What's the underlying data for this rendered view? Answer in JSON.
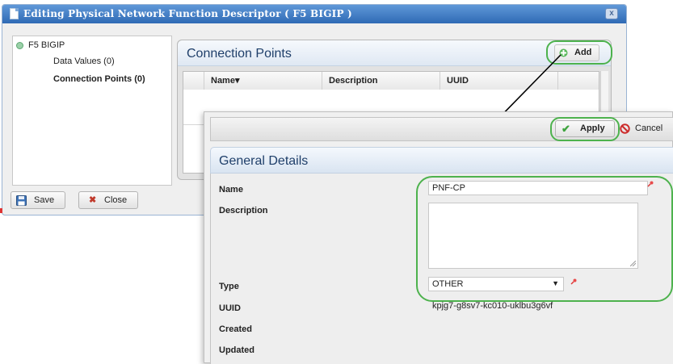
{
  "window": {
    "title": "Editing Physical Network Function Descriptor ( F5 BIGIP )",
    "close_symbol": "x"
  },
  "tree": {
    "root": "F5 BIGIP",
    "items": [
      {
        "label": "Data Values (0)"
      },
      {
        "label": "Connection Points (0)"
      }
    ]
  },
  "connection_points": {
    "title": "Connection Points",
    "add_label": "Add",
    "columns": [
      "Name",
      "Description",
      "UUID"
    ],
    "sort_indicator": "▾"
  },
  "footer": {
    "save_label": "Save",
    "close_label": "Close"
  },
  "detail_toolbar": {
    "apply_label": "Apply",
    "cancel_label": "Cancel"
  },
  "general_details": {
    "title": "General Details",
    "fields": {
      "name_label": "Name",
      "name_value": "PNF-CP",
      "description_label": "Description",
      "description_value": "",
      "type_label": "Type",
      "type_value": "OTHER",
      "uuid_label": "UUID",
      "uuid_value": "kpjg7-g8sv7-kc010-uklbu3g6vf",
      "created_label": "Created",
      "updated_label": "Updated"
    }
  },
  "colors": {
    "title_bar": "#2f6ab5",
    "highlight": "#4db24d",
    "heading_text": "#1f3f6a"
  }
}
